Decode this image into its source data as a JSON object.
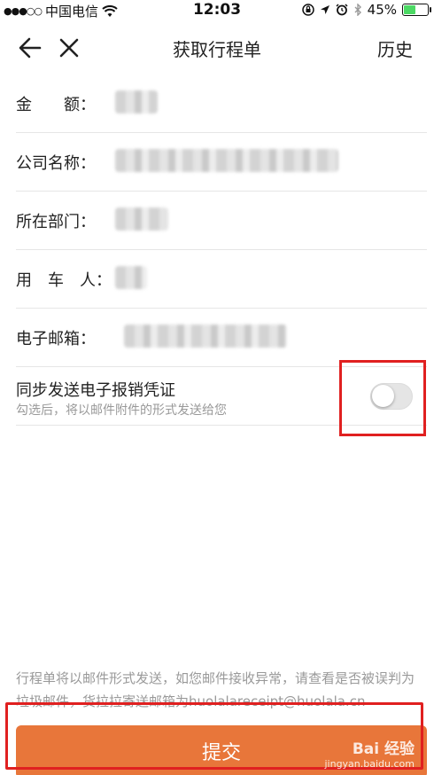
{
  "status_bar": {
    "signal_dots": "●●●○○",
    "carrier": "中国电信",
    "time": "12:03",
    "battery": "45%",
    "battery_level": 0.45,
    "icons": [
      "wifi-icon",
      "orientation-lock-icon",
      "location-icon",
      "alarm-icon",
      "bluetooth-icon",
      "battery-icon"
    ]
  },
  "nav": {
    "title": "获取行程单",
    "history_label": "历史",
    "icons": [
      "back-arrow-icon",
      "close-icon"
    ]
  },
  "form": {
    "fields": [
      {
        "label": "金　　额："
      },
      {
        "label": "公司名称："
      },
      {
        "label": "所在部门："
      },
      {
        "label": "用　车　人："
      },
      {
        "label": "电子邮箱："
      }
    ],
    "sync": {
      "title": "同步发送电子报销凭证",
      "subtitle": "勾选后，将以邮件附件的形式发送给您",
      "enabled": false
    }
  },
  "notice": "行程单将以邮件形式发送，如您邮件接收异常，请查看是否被误判为垃圾邮件，货拉拉寄送邮箱为huolalareceipt@huolala.cn",
  "submit_label": "提交",
  "watermark": {
    "line1": "Bai 经验",
    "line2": "jingyan.baidu.com"
  },
  "colors": {
    "accent": "#e8763a",
    "annotation": "#e02020"
  }
}
